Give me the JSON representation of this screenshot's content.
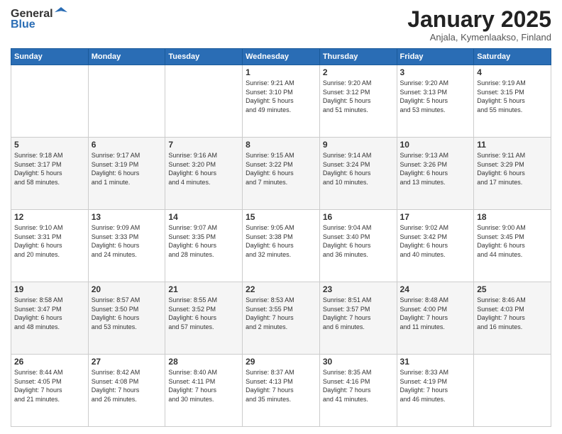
{
  "header": {
    "logo_general": "General",
    "logo_blue": "Blue",
    "month_title": "January 2025",
    "subtitle": "Anjala, Kymenlaakso, Finland"
  },
  "days_of_week": [
    "Sunday",
    "Monday",
    "Tuesday",
    "Wednesday",
    "Thursday",
    "Friday",
    "Saturday"
  ],
  "weeks": [
    [
      {
        "day": "",
        "info": ""
      },
      {
        "day": "",
        "info": ""
      },
      {
        "day": "",
        "info": ""
      },
      {
        "day": "1",
        "info": "Sunrise: 9:21 AM\nSunset: 3:10 PM\nDaylight: 5 hours\nand 49 minutes."
      },
      {
        "day": "2",
        "info": "Sunrise: 9:20 AM\nSunset: 3:12 PM\nDaylight: 5 hours\nand 51 minutes."
      },
      {
        "day": "3",
        "info": "Sunrise: 9:20 AM\nSunset: 3:13 PM\nDaylight: 5 hours\nand 53 minutes."
      },
      {
        "day": "4",
        "info": "Sunrise: 9:19 AM\nSunset: 3:15 PM\nDaylight: 5 hours\nand 55 minutes."
      }
    ],
    [
      {
        "day": "5",
        "info": "Sunrise: 9:18 AM\nSunset: 3:17 PM\nDaylight: 5 hours\nand 58 minutes."
      },
      {
        "day": "6",
        "info": "Sunrise: 9:17 AM\nSunset: 3:19 PM\nDaylight: 6 hours\nand 1 minute."
      },
      {
        "day": "7",
        "info": "Sunrise: 9:16 AM\nSunset: 3:20 PM\nDaylight: 6 hours\nand 4 minutes."
      },
      {
        "day": "8",
        "info": "Sunrise: 9:15 AM\nSunset: 3:22 PM\nDaylight: 6 hours\nand 7 minutes."
      },
      {
        "day": "9",
        "info": "Sunrise: 9:14 AM\nSunset: 3:24 PM\nDaylight: 6 hours\nand 10 minutes."
      },
      {
        "day": "10",
        "info": "Sunrise: 9:13 AM\nSunset: 3:26 PM\nDaylight: 6 hours\nand 13 minutes."
      },
      {
        "day": "11",
        "info": "Sunrise: 9:11 AM\nSunset: 3:29 PM\nDaylight: 6 hours\nand 17 minutes."
      }
    ],
    [
      {
        "day": "12",
        "info": "Sunrise: 9:10 AM\nSunset: 3:31 PM\nDaylight: 6 hours\nand 20 minutes."
      },
      {
        "day": "13",
        "info": "Sunrise: 9:09 AM\nSunset: 3:33 PM\nDaylight: 6 hours\nand 24 minutes."
      },
      {
        "day": "14",
        "info": "Sunrise: 9:07 AM\nSunset: 3:35 PM\nDaylight: 6 hours\nand 28 minutes."
      },
      {
        "day": "15",
        "info": "Sunrise: 9:05 AM\nSunset: 3:38 PM\nDaylight: 6 hours\nand 32 minutes."
      },
      {
        "day": "16",
        "info": "Sunrise: 9:04 AM\nSunset: 3:40 PM\nDaylight: 6 hours\nand 36 minutes."
      },
      {
        "day": "17",
        "info": "Sunrise: 9:02 AM\nSunset: 3:42 PM\nDaylight: 6 hours\nand 40 minutes."
      },
      {
        "day": "18",
        "info": "Sunrise: 9:00 AM\nSunset: 3:45 PM\nDaylight: 6 hours\nand 44 minutes."
      }
    ],
    [
      {
        "day": "19",
        "info": "Sunrise: 8:58 AM\nSunset: 3:47 PM\nDaylight: 6 hours\nand 48 minutes."
      },
      {
        "day": "20",
        "info": "Sunrise: 8:57 AM\nSunset: 3:50 PM\nDaylight: 6 hours\nand 53 minutes."
      },
      {
        "day": "21",
        "info": "Sunrise: 8:55 AM\nSunset: 3:52 PM\nDaylight: 6 hours\nand 57 minutes."
      },
      {
        "day": "22",
        "info": "Sunrise: 8:53 AM\nSunset: 3:55 PM\nDaylight: 7 hours\nand 2 minutes."
      },
      {
        "day": "23",
        "info": "Sunrise: 8:51 AM\nSunset: 3:57 PM\nDaylight: 7 hours\nand 6 minutes."
      },
      {
        "day": "24",
        "info": "Sunrise: 8:48 AM\nSunset: 4:00 PM\nDaylight: 7 hours\nand 11 minutes."
      },
      {
        "day": "25",
        "info": "Sunrise: 8:46 AM\nSunset: 4:03 PM\nDaylight: 7 hours\nand 16 minutes."
      }
    ],
    [
      {
        "day": "26",
        "info": "Sunrise: 8:44 AM\nSunset: 4:05 PM\nDaylight: 7 hours\nand 21 minutes."
      },
      {
        "day": "27",
        "info": "Sunrise: 8:42 AM\nSunset: 4:08 PM\nDaylight: 7 hours\nand 26 minutes."
      },
      {
        "day": "28",
        "info": "Sunrise: 8:40 AM\nSunset: 4:11 PM\nDaylight: 7 hours\nand 30 minutes."
      },
      {
        "day": "29",
        "info": "Sunrise: 8:37 AM\nSunset: 4:13 PM\nDaylight: 7 hours\nand 35 minutes."
      },
      {
        "day": "30",
        "info": "Sunrise: 8:35 AM\nSunset: 4:16 PM\nDaylight: 7 hours\nand 41 minutes."
      },
      {
        "day": "31",
        "info": "Sunrise: 8:33 AM\nSunset: 4:19 PM\nDaylight: 7 hours\nand 46 minutes."
      },
      {
        "day": "",
        "info": ""
      }
    ]
  ]
}
